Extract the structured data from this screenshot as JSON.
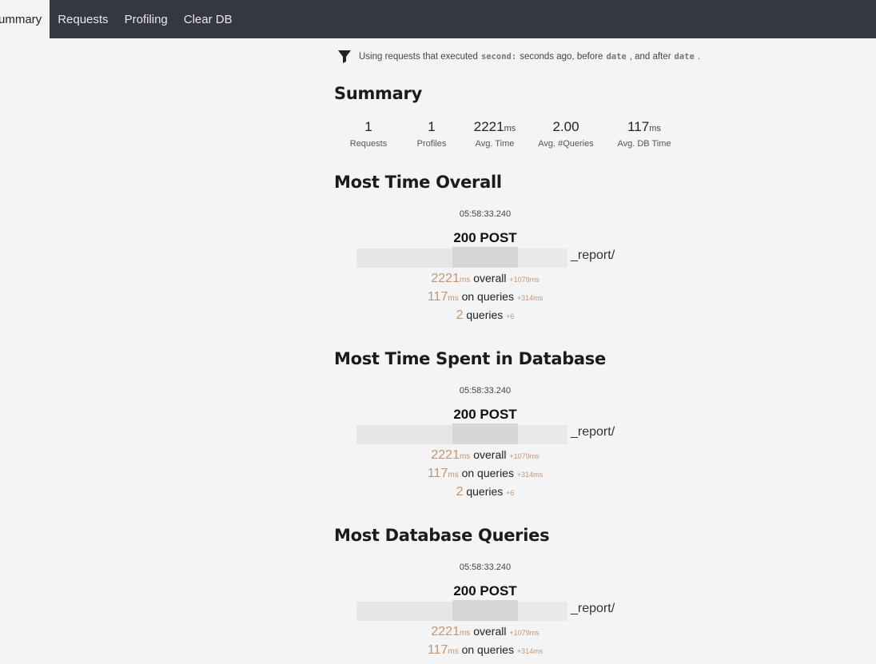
{
  "nav": {
    "items": [
      {
        "label": "Summary",
        "active": true
      },
      {
        "label": "Requests",
        "active": false
      },
      {
        "label": "Profiling",
        "active": false
      },
      {
        "label": "Clear DB",
        "active": false
      }
    ]
  },
  "filter": {
    "prefix": "Using requests that executed",
    "seconds_token": "second:",
    "middle": "seconds ago, before",
    "date_token_1": "date",
    "after_text": ", and after",
    "date_token_2": "date",
    "suffix": "."
  },
  "summary": {
    "title": "Summary",
    "stats": [
      {
        "value": "1",
        "unit": "",
        "label": "Requests"
      },
      {
        "value": "1",
        "unit": "",
        "label": "Profiles"
      },
      {
        "value": "2221",
        "unit": "ms",
        "label": "Avg. Time"
      },
      {
        "value": "2.00",
        "unit": "",
        "label": "Avg. #Queries"
      },
      {
        "value": "117",
        "unit": "ms",
        "label": "Avg. DB Time"
      }
    ]
  },
  "sections": [
    {
      "title": "Most Time Overall",
      "time": "05:58:33.240",
      "status": "200 POST",
      "url_suffix": "_report/",
      "overall": {
        "value": "2221",
        "unit": "ms",
        "label": "overall",
        "delta": "+1079ms"
      },
      "queries_time": {
        "value": "117",
        "unit": "ms",
        "label": "on queries",
        "delta": "+314ms"
      },
      "queries_count": {
        "value": "2",
        "label": "queries",
        "delta": "+6"
      }
    },
    {
      "title": "Most Time Spent in Database",
      "time": "05:58:33.240",
      "status": "200 POST",
      "url_suffix": "_report/",
      "overall": {
        "value": "2221",
        "unit": "ms",
        "label": "overall",
        "delta": "+1079ms"
      },
      "queries_time": {
        "value": "117",
        "unit": "ms",
        "label": "on queries",
        "delta": "+314ms"
      },
      "queries_count": {
        "value": "2",
        "label": "queries",
        "delta": "+6"
      }
    },
    {
      "title": "Most Database Queries",
      "time": "05:58:33.240",
      "status": "200 POST",
      "url_suffix": "_report/",
      "overall": {
        "value": "2221",
        "unit": "ms",
        "label": "overall",
        "delta": "+1079ms"
      },
      "queries_time": {
        "value": "117",
        "unit": "ms",
        "label": "on queries",
        "delta": "+314ms"
      }
    }
  ],
  "colors": {
    "nav_bg": "#353843",
    "page_bg": "#f4f4f4",
    "accent": "#c79470"
  },
  "icons": {
    "filter": "funnel-icon"
  }
}
